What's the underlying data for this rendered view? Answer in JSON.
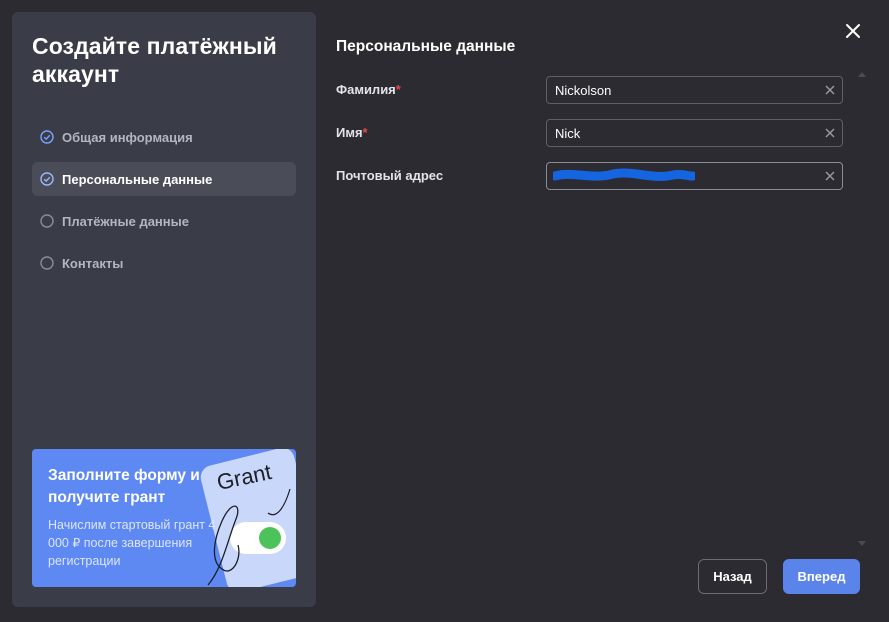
{
  "dialog": {
    "title": "Создайте платёжный аккаунт",
    "close_icon": "close-icon"
  },
  "steps": [
    {
      "label": "Общая информация",
      "state": "done",
      "icon": "check-circle-icon"
    },
    {
      "label": "Персональные данные",
      "state": "active",
      "icon": "check-circle-icon"
    },
    {
      "label": "Платёжные данные",
      "state": "pending",
      "icon": "empty-circle-icon"
    },
    {
      "label": "Контакты",
      "state": "pending",
      "icon": "empty-circle-icon"
    }
  ],
  "promo": {
    "title": "Заполните форму и получите грант",
    "text": "Начислим стартовый грант 4 000 ₽ после завершения регистрации",
    "card_label": "Grant"
  },
  "form": {
    "section_title": "Персональные данные",
    "last_name": {
      "label": "Фамилия",
      "required_mark": "*",
      "value": "Nickolson"
    },
    "first_name": {
      "label": "Имя",
      "required_mark": "*",
      "value": "Nick"
    },
    "email": {
      "label": "Почтовый адрес",
      "value": ""
    }
  },
  "buttons": {
    "back": "Назад",
    "next": "Вперед"
  },
  "colors": {
    "accent": "#5a84ea",
    "promo_bg": "#5e88f2",
    "required": "#e5484d",
    "redaction": "#1565e0"
  }
}
